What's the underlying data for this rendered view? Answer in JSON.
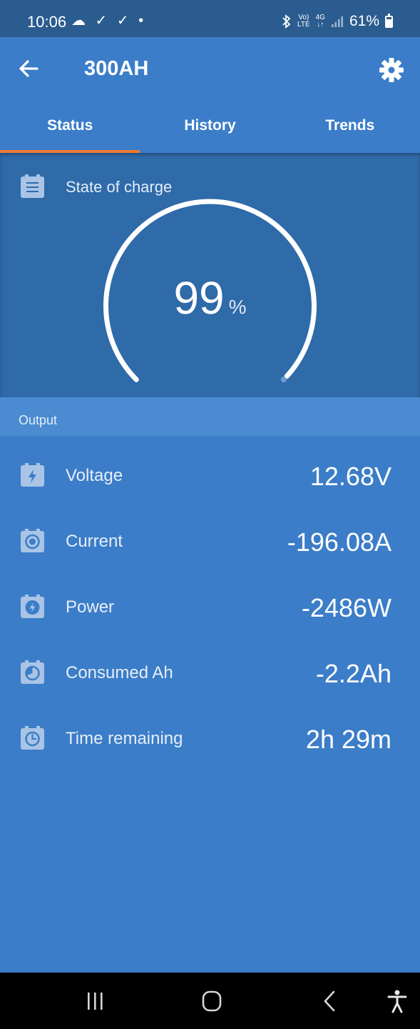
{
  "status_bar": {
    "time": "10:06",
    "notifications": "☁ ✓ ✓ •",
    "volte_top": "Vo)",
    "volte_bottom": "LTE",
    "net_top": "4G",
    "net_bottom": "↓↑",
    "battery": "61%"
  },
  "app_bar": {
    "title": "300AH",
    "back_icon": "arrow-left-icon",
    "settings_icon": "gear-icon"
  },
  "tabs": [
    {
      "label": "Status",
      "active": true
    },
    {
      "label": "History",
      "active": false
    },
    {
      "label": "Trends",
      "active": false
    }
  ],
  "soc": {
    "label": "State of charge",
    "value": "99",
    "unit": "%",
    "level_percent": 99
  },
  "output": {
    "section_label": "Output",
    "rows": [
      {
        "label": "Voltage",
        "value": "12.68V",
        "icon": "bolt-icon"
      },
      {
        "label": "Current",
        "value": "-196.08A",
        "icon": "current-icon"
      },
      {
        "label": "Power",
        "value": "-2486W",
        "icon": "power-icon"
      },
      {
        "label": "Consumed Ah",
        "value": "-2.2Ah",
        "icon": "consumed-icon"
      },
      {
        "label": "Time remaining",
        "value": "2h 29m",
        "icon": "clock-icon"
      }
    ]
  },
  "colors": {
    "primary": "#3b7dc8",
    "panel": "#2f6aa9",
    "section": "#4a8bd1",
    "accent": "#f07a33",
    "status_bar": "#2b5c8f"
  },
  "nav": {
    "recents_icon": "recents-icon",
    "home_icon": "home-icon",
    "back_icon": "back-chevron-icon",
    "accessibility_icon": "accessibility-icon"
  }
}
